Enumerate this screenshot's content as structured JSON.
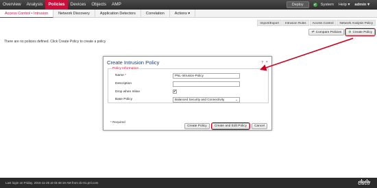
{
  "topnav": {
    "items": [
      "Overview",
      "Analysis",
      "Policies",
      "Devices",
      "Objects",
      "AMP"
    ],
    "active_index": 2
  },
  "topright": {
    "deploy": "Deploy",
    "status_icon": "check-icon",
    "status_glyph": "✔",
    "system": "System",
    "help": "Help ▾",
    "user": "admin ▾"
  },
  "subnav": {
    "items": [
      "Access Control • Intrusion",
      "Network Discovery",
      "Application Detectors",
      "Correlation",
      "Actions ▾"
    ],
    "active_index": 0
  },
  "links": [
    "Import/Export",
    "Intrusion Rules",
    "Access Control",
    "Network Analysis Policy"
  ],
  "actions": {
    "compare": "Compare Policies",
    "create": "Create Policy"
  },
  "main": {
    "empty_message": "There are no policies defined. Click Create Policy to create a policy"
  },
  "dialog": {
    "title": "Create Intrusion Policy",
    "help": "? ",
    "close": "×",
    "legend": "Policy Information",
    "name_label": "Name",
    "required_star": "*",
    "name_value": "PNL-Intrusion-Policy",
    "description_label": "Description",
    "description_value": "",
    "drop_label": "Drop when Inline",
    "drop_checked": true,
    "check_glyph": "✔",
    "base_label": "Base Policy",
    "base_value": "Balanced Security and Connectivity",
    "required_note": "Required",
    "buttons": {
      "create": "Create Policy",
      "create_edit": "Create and Edit Policy",
      "cancel": "Cancel"
    }
  },
  "footer": {
    "last_login": "Last login on Friday, 2016-11-25 at 03:48:19 AM from dc-01.pnl.com",
    "brand": "CISCO"
  },
  "colors": {
    "accent": "#c8103a",
    "highlight": "#d0021b",
    "dialog_title": "#1c3f73"
  }
}
